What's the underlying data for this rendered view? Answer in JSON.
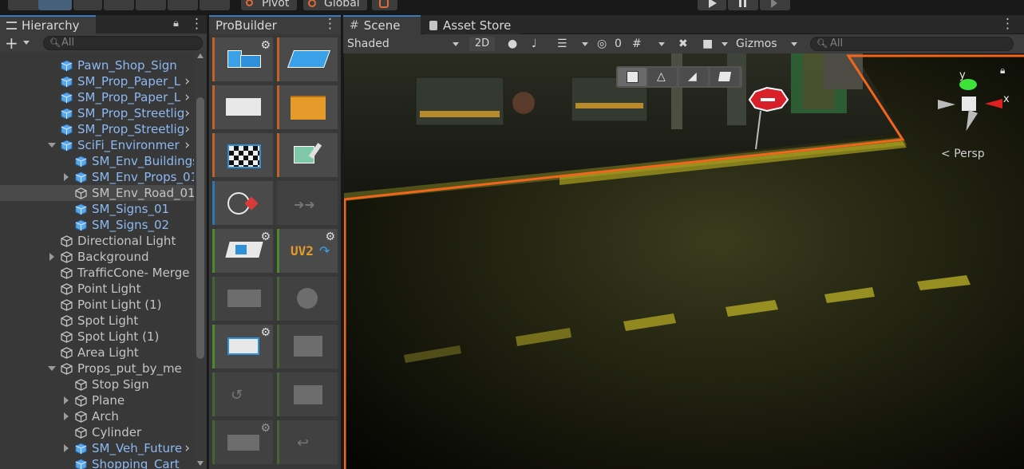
{
  "toolbar": {
    "pivot_label": "Pivot",
    "global_label": "Global"
  },
  "hierarchy": {
    "tab_label": "Hierarchy",
    "add_label": "+",
    "search_placeholder": "All",
    "rows": [
      {
        "label": "Pawn_Shop_Sign",
        "indent": 1,
        "prefab": true,
        "fold": "none",
        "arrow": false
      },
      {
        "label": "SM_Prop_Paper_L",
        "indent": 1,
        "prefab": true,
        "fold": "none",
        "arrow": true
      },
      {
        "label": "SM_Prop_Paper_L",
        "indent": 1,
        "prefab": true,
        "fold": "none",
        "arrow": true
      },
      {
        "label": "SM_Prop_Streetlig",
        "indent": 1,
        "prefab": true,
        "fold": "none",
        "arrow": true
      },
      {
        "label": "SM_Prop_Streetlig",
        "indent": 1,
        "prefab": true,
        "fold": "none",
        "arrow": true
      },
      {
        "label": "SciFi_Environmer",
        "indent": 1,
        "prefab": true,
        "fold": "open",
        "arrow": true
      },
      {
        "label": "SM_Env_Buildings",
        "indent": 2,
        "prefab": true,
        "fold": "none",
        "arrow": false
      },
      {
        "label": "SM_Env_Props_01",
        "indent": 2,
        "prefab": true,
        "fold": "closed",
        "arrow": false
      },
      {
        "label": "SM_Env_Road_01",
        "indent": 2,
        "prefab": false,
        "fold": "none",
        "arrow": false,
        "selected": true
      },
      {
        "label": "SM_Signs_01",
        "indent": 2,
        "prefab": true,
        "fold": "none",
        "arrow": false
      },
      {
        "label": "SM_Signs_02",
        "indent": 2,
        "prefab": true,
        "fold": "none",
        "arrow": false
      },
      {
        "label": "Directional Light",
        "indent": 1,
        "prefab": false,
        "fold": "none",
        "arrow": false
      },
      {
        "label": "Background",
        "indent": 1,
        "prefab": false,
        "fold": "closed",
        "arrow": false
      },
      {
        "label": "TrafficCone- Merge",
        "indent": 1,
        "prefab": false,
        "fold": "none",
        "arrow": false
      },
      {
        "label": "Point Light",
        "indent": 1,
        "prefab": false,
        "fold": "none",
        "arrow": false
      },
      {
        "label": "Point Light (1)",
        "indent": 1,
        "prefab": false,
        "fold": "none",
        "arrow": false
      },
      {
        "label": "Spot Light",
        "indent": 1,
        "prefab": false,
        "fold": "none",
        "arrow": false
      },
      {
        "label": "Spot Light (1)",
        "indent": 1,
        "prefab": false,
        "fold": "none",
        "arrow": false
      },
      {
        "label": "Area Light",
        "indent": 1,
        "prefab": false,
        "fold": "none",
        "arrow": false
      },
      {
        "label": "Props_put_by_me",
        "indent": 1,
        "prefab": false,
        "fold": "open",
        "arrow": false
      },
      {
        "label": "Stop Sign",
        "indent": 2,
        "prefab": false,
        "fold": "none",
        "arrow": false
      },
      {
        "label": "Plane",
        "indent": 2,
        "prefab": false,
        "fold": "closed",
        "arrow": false
      },
      {
        "label": "Arch",
        "indent": 2,
        "prefab": false,
        "fold": "closed",
        "arrow": false
      },
      {
        "label": "Cylinder",
        "indent": 2,
        "prefab": false,
        "fold": "none",
        "arrow": false
      },
      {
        "label": "SM_Veh_Future",
        "indent": 2,
        "prefab": true,
        "fold": "closed",
        "arrow": true
      },
      {
        "label": "Shopping_Cart",
        "indent": 2,
        "prefab": true,
        "fold": "none",
        "arrow": false
      }
    ]
  },
  "probuilder": {
    "tab_label": "ProBuilder",
    "uv2_label": "UV2"
  },
  "scene": {
    "tab_label": "Scene",
    "asset_store_label": "Asset Store",
    "shading_mode": "Shaded",
    "mode_2d": "2D",
    "hidden_count": "0",
    "gizmos_label": "Gizmos",
    "search_placeholder": "All",
    "projection_label": "Persp",
    "axis_y": "y",
    "axis_x": "x"
  },
  "colors": {
    "accent_blue": "#3a79bb",
    "selection_outline": "#f2661c",
    "prefab_text": "#8cb9f2"
  }
}
